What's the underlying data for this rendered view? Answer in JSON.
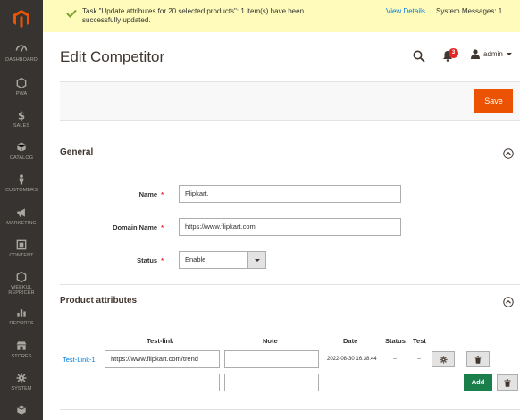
{
  "sidebar": {
    "items": [
      {
        "label": "DASHBOARD",
        "icon": "dashboard-icon"
      },
      {
        "label": "PWA",
        "icon": "hexagon-icon"
      },
      {
        "label": "SALES",
        "icon": "dollar-icon"
      },
      {
        "label": "CATALOG",
        "icon": "cube-icon"
      },
      {
        "label": "CUSTOMERS",
        "icon": "person-icon"
      },
      {
        "label": "MARKETING",
        "icon": "megaphone-icon"
      },
      {
        "label": "CONTENT",
        "icon": "content-icon"
      },
      {
        "label": "WEEKUL\nREPRICER",
        "icon": "hexagon-icon"
      },
      {
        "label": "REPORTS",
        "icon": "bar-chart-icon"
      },
      {
        "label": "STORES",
        "icon": "store-icon"
      },
      {
        "label": "SYSTEM",
        "icon": "gear-icon"
      },
      {
        "label": "",
        "icon": "box-icon"
      }
    ]
  },
  "message": {
    "text": "Task \"Update attributes for 20 selected products\": 1 item(s) have been successfully updated.",
    "link": "View Details",
    "system": "System Messages: 1"
  },
  "header": {
    "title": "Edit Competitor",
    "notification_count": "3",
    "user": "admin"
  },
  "actions": {
    "save_label": "Save"
  },
  "general": {
    "title": "General",
    "name_label": "Name",
    "name_value": "Flipkart.",
    "domain_label": "Domain Name",
    "domain_value": "https://www.flipkart.com",
    "status_label": "Status",
    "status_value": "Enable",
    "required_mark": "*"
  },
  "attributes": {
    "title": "Product attributes",
    "columns": [
      "Test-link",
      "Note",
      "Date",
      "Status",
      "Test"
    ],
    "rows": [
      {
        "name": "Test-Link-1",
        "link": "https://www.flipkart.com/trend",
        "note": "",
        "date": "2022-08-30 16:38:44",
        "status": "--",
        "test": "--"
      },
      {
        "name": "",
        "link": "",
        "note": "",
        "date": "--",
        "status": "--",
        "test": "--"
      }
    ],
    "add_label": "Add"
  },
  "colors": {
    "sidebar": "#373330",
    "accent": "#eb5202",
    "add": "#1b7f4c",
    "link": "#007bdb"
  }
}
